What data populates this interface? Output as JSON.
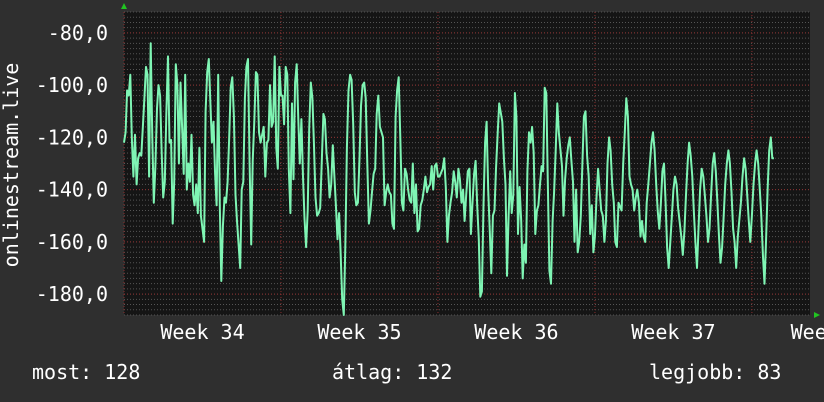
{
  "chart_data": {
    "type": "line",
    "ylabel": "onlinestream.live",
    "ylim": [
      -188,
      -72
    ],
    "yticks": [
      -80,
      -100,
      -120,
      -140,
      -160,
      -180
    ],
    "ytick_labels": [
      "-80,0",
      "-100,0",
      "-120,0",
      "-140,0",
      "-160,0",
      "-180,0"
    ],
    "xlim": [
      0,
      4.37
    ],
    "xticks": [
      0.5,
      1.5,
      2.5,
      3.5,
      4.4
    ],
    "xtick_labels": [
      "Week 34",
      "Week 35",
      "Week 36",
      "Week 37",
      "Week"
    ],
    "grid": true,
    "colors": {
      "line": "#7ff5b4",
      "background": "#2f2f2f",
      "plot_background": "#151515",
      "grid_major": "#8a2e2e",
      "grid_minor": "#555555",
      "arrow": "#21c421"
    },
    "x": [
      0.0,
      0.01,
      0.02,
      0.03,
      0.04,
      0.05,
      0.06,
      0.07,
      0.08,
      0.09,
      0.1,
      0.11,
      0.13,
      0.14,
      0.15,
      0.16,
      0.17,
      0.18,
      0.19,
      0.2,
      0.21,
      0.22,
      0.23,
      0.24,
      0.25,
      0.26,
      0.27,
      0.28,
      0.29,
      0.3,
      0.31,
      0.32,
      0.33,
      0.34,
      0.35,
      0.36,
      0.37,
      0.38,
      0.39,
      0.4,
      0.41,
      0.42,
      0.43,
      0.44,
      0.45,
      0.46,
      0.47,
      0.48,
      0.49,
      0.51,
      0.52,
      0.53,
      0.54,
      0.55,
      0.56,
      0.57,
      0.58,
      0.59,
      0.6,
      0.61,
      0.62,
      0.63,
      0.64,
      0.65,
      0.66,
      0.67,
      0.68,
      0.69,
      0.7,
      0.71,
      0.72,
      0.73,
      0.74,
      0.75,
      0.76,
      0.77,
      0.78,
      0.79,
      0.8,
      0.81,
      0.82,
      0.83,
      0.84,
      0.85,
      0.86,
      0.87,
      0.89,
      0.9,
      0.91,
      0.92,
      0.93,
      0.94,
      0.95,
      0.96,
      0.97,
      0.98,
      0.99,
      1.0,
      1.01,
      1.02,
      1.03,
      1.04,
      1.05,
      1.06,
      1.07,
      1.08,
      1.09,
      1.1,
      1.11,
      1.12,
      1.13,
      1.14,
      1.15,
      1.16,
      1.17,
      1.18,
      1.19,
      1.2,
      1.21,
      1.22,
      1.23,
      1.24,
      1.25,
      1.27,
      1.28,
      1.29,
      1.3,
      1.31,
      1.32,
      1.33,
      1.34,
      1.35,
      1.36,
      1.37,
      1.38,
      1.39,
      1.4,
      1.41,
      1.42,
      1.43,
      1.44,
      1.45,
      1.46,
      1.47,
      1.48,
      1.49,
      1.5,
      1.51,
      1.52,
      1.53,
      1.54,
      1.55,
      1.56,
      1.57,
      1.58,
      1.59,
      1.6,
      1.61,
      1.62,
      1.63,
      1.65,
      1.66,
      1.67,
      1.68,
      1.69,
      1.7,
      1.71,
      1.72,
      1.73,
      1.74,
      1.75,
      1.76,
      1.77,
      1.78,
      1.79,
      1.8,
      1.81,
      1.82,
      1.83,
      1.84,
      1.85,
      1.86,
      1.87,
      1.88,
      1.89,
      1.9,
      1.91,
      1.92,
      1.93,
      1.94,
      1.95,
      1.96,
      1.97,
      1.98,
      1.99,
      2.0,
      2.01,
      2.03,
      2.04,
      2.05,
      2.06,
      2.07,
      2.08,
      2.09,
      2.1,
      2.11,
      2.12,
      2.13,
      2.14,
      2.15,
      2.16,
      2.17,
      2.18,
      2.19,
      2.2,
      2.21,
      2.22,
      2.23,
      2.24,
      2.25,
      2.26,
      2.27,
      2.28,
      2.29,
      2.3,
      2.31,
      2.32,
      2.33,
      2.34,
      2.35,
      2.36,
      2.37,
      2.38,
      2.39,
      2.41,
      2.42,
      2.43,
      2.44,
      2.45,
      2.46,
      2.47,
      2.48,
      2.49,
      2.5,
      2.51,
      2.52,
      2.53,
      2.54,
      2.55,
      2.56,
      2.57,
      2.58,
      2.59,
      2.6,
      2.61,
      2.62,
      2.63,
      2.64,
      2.65,
      2.66,
      2.67,
      2.68,
      2.69,
      2.7,
      2.71,
      2.72,
      2.73,
      2.74,
      2.75,
      2.76,
      2.77,
      2.79,
      2.8,
      2.81,
      2.82,
      2.83,
      2.84,
      2.85,
      2.86,
      2.87,
      2.88,
      2.89,
      2.9,
      2.91,
      2.92,
      2.93,
      2.94,
      2.95,
      2.96,
      2.97,
      2.98,
      2.99,
      3.0,
      3.01,
      3.02,
      3.03,
      3.04,
      3.05,
      3.06,
      3.07,
      3.08,
      3.09,
      3.1,
      3.11,
      3.12,
      3.13,
      3.14,
      3.15,
      3.17,
      3.18,
      3.19,
      3.2,
      3.21,
      3.22,
      3.23,
      3.24,
      3.25,
      3.26,
      3.27,
      3.28,
      3.29,
      3.3,
      3.31,
      3.32,
      3.33,
      3.34,
      3.35,
      3.36,
      3.37,
      3.38,
      3.39,
      3.4,
      3.41,
      3.42,
      3.43,
      3.44,
      3.45,
      3.46,
      3.47,
      3.48,
      3.49,
      3.5,
      3.51,
      3.52,
      3.53,
      3.55,
      3.56,
      3.57,
      3.58,
      3.59,
      3.6,
      3.61,
      3.62,
      3.63,
      3.64,
      3.65,
      3.66,
      3.67,
      3.68,
      3.69,
      3.7,
      3.71,
      3.72,
      3.73,
      3.74,
      3.75,
      3.76,
      3.77,
      3.78,
      3.79,
      3.8,
      3.81,
      3.82,
      3.83,
      3.84,
      3.85,
      3.86,
      3.87,
      3.88,
      3.89,
      3.9,
      3.91,
      3.93,
      3.94,
      3.95,
      3.96,
      3.97,
      3.98,
      3.99,
      4.0,
      4.01,
      4.02,
      4.03,
      4.04,
      4.05,
      4.06,
      4.07,
      4.08,
      4.09,
      4.1,
      4.11,
      4.12,
      4.13,
      4.14,
      4.15,
      4.16,
      4.17,
      4.18,
      4.19,
      4.2,
      4.21,
      4.22,
      4.23,
      4.24,
      4.25,
      4.26,
      4.27,
      4.28,
      4.29,
      4.31,
      4.32,
      4.33,
      4.34,
      4.35,
      4.36
    ],
    "y": [
      -122,
      -118,
      -102,
      -104,
      -96,
      -120,
      -135,
      -119,
      -138,
      -128,
      -126,
      -127,
      -105,
      -93,
      -96,
      -135,
      -84,
      -120,
      -145,
      -131,
      -109,
      -100,
      -104,
      -126,
      -143,
      -137,
      -110,
      -89,
      -122,
      -121,
      -153,
      -137,
      -92,
      -100,
      -130,
      -99,
      -116,
      -134,
      -96,
      -140,
      -130,
      -137,
      -119,
      -142,
      -146,
      -138,
      -149,
      -124,
      -150,
      -160,
      -110,
      -95,
      -90,
      -106,
      -122,
      -114,
      -133,
      -146,
      -96,
      -146,
      -175,
      -154,
      -143,
      -145,
      -137,
      -120,
      -101,
      -97,
      -112,
      -142,
      -152,
      -161,
      -170,
      -140,
      -137,
      -105,
      -93,
      -90,
      -130,
      -161,
      -129,
      -114,
      -95,
      -96,
      -118,
      -122,
      -116,
      -135,
      -122,
      -121,
      -100,
      -116,
      -114,
      -89,
      -124,
      -132,
      -93,
      -104,
      -104,
      -115,
      -93,
      -96,
      -132,
      -149,
      -107,
      -136,
      -99,
      -92,
      -112,
      -130,
      -113,
      -135,
      -151,
      -162,
      -148,
      -117,
      -99,
      -105,
      -122,
      -143,
      -150,
      -149,
      -147,
      -111,
      -113,
      -126,
      -132,
      -143,
      -138,
      -123,
      -135,
      -146,
      -159,
      -149,
      -164,
      -182,
      -188,
      -162,
      -124,
      -102,
      -96,
      -98,
      -115,
      -141,
      -146,
      -145,
      -128,
      -108,
      -100,
      -99,
      -105,
      -130,
      -153,
      -148,
      -141,
      -134,
      -132,
      -111,
      -104,
      -116,
      -120,
      -146,
      -141,
      -138,
      -141,
      -142,
      -153,
      -155,
      -112,
      -102,
      -97,
      -120,
      -145,
      -148,
      -132,
      -134,
      -140,
      -144,
      -145,
      -130,
      -149,
      -138,
      -156,
      -155,
      -146,
      -144,
      -140,
      -135,
      -141,
      -139,
      -138,
      -131,
      -140,
      -131,
      -130,
      -135,
      -135,
      -132,
      -128,
      -139,
      -160,
      -150,
      -145,
      -141,
      -133,
      -137,
      -143,
      -132,
      -136,
      -145,
      -140,
      -152,
      -142,
      -133,
      -132,
      -157,
      -145,
      -134,
      -129,
      -146,
      -159,
      -181,
      -179,
      -146,
      -122,
      -114,
      -140,
      -156,
      -172,
      -150,
      -148,
      -132,
      -119,
      -107,
      -114,
      -128,
      -138,
      -173,
      -150,
      -133,
      -149,
      -142,
      -103,
      -112,
      -157,
      -139,
      -152,
      -174,
      -161,
      -168,
      -133,
      -118,
      -122,
      -116,
      -126,
      -157,
      -148,
      -146,
      -138,
      -131,
      -133,
      -101,
      -103,
      -137,
      -171,
      -176,
      -152,
      -141,
      -125,
      -107,
      -118,
      -131,
      -150,
      -136,
      -128,
      -123,
      -120,
      -129,
      -137,
      -160,
      -140,
      -164,
      -160,
      -150,
      -130,
      -112,
      -110,
      -127,
      -135,
      -157,
      -146,
      -164,
      -158,
      -143,
      -132,
      -140,
      -148,
      -150,
      -160,
      -152,
      -130,
      -120,
      -125,
      -138,
      -145,
      -160,
      -162,
      -145,
      -148,
      -130,
      -118,
      -105,
      -112,
      -135,
      -138,
      -140,
      -148,
      -143,
      -140,
      -145,
      -158,
      -152,
      -158,
      -160,
      -145,
      -138,
      -130,
      -122,
      -118,
      -125,
      -138,
      -148,
      -155,
      -145,
      -133,
      -130,
      -145,
      -162,
      -170,
      -160,
      -150,
      -140,
      -135,
      -138,
      -147,
      -158,
      -165,
      -156,
      -142,
      -130,
      -122,
      -127,
      -135,
      -148,
      -160,
      -170,
      -155,
      -140,
      -132,
      -135,
      -142,
      -150,
      -160,
      -155,
      -142,
      -130,
      -126,
      -133,
      -145,
      -158,
      -168,
      -162,
      -150,
      -138,
      -130,
      -125,
      -130,
      -141,
      -155,
      -160,
      -170,
      -158,
      -145,
      -135,
      -128,
      -132,
      -142,
      -152,
      -160,
      -150,
      -138,
      -130,
      -125,
      -130,
      -140,
      -150,
      -165,
      -176,
      -160,
      -140,
      -125,
      -120,
      -128,
      -128
    ]
  },
  "footer": {
    "current": "most: 128",
    "average": "átlag: 132",
    "best": "legjobb: 83"
  }
}
